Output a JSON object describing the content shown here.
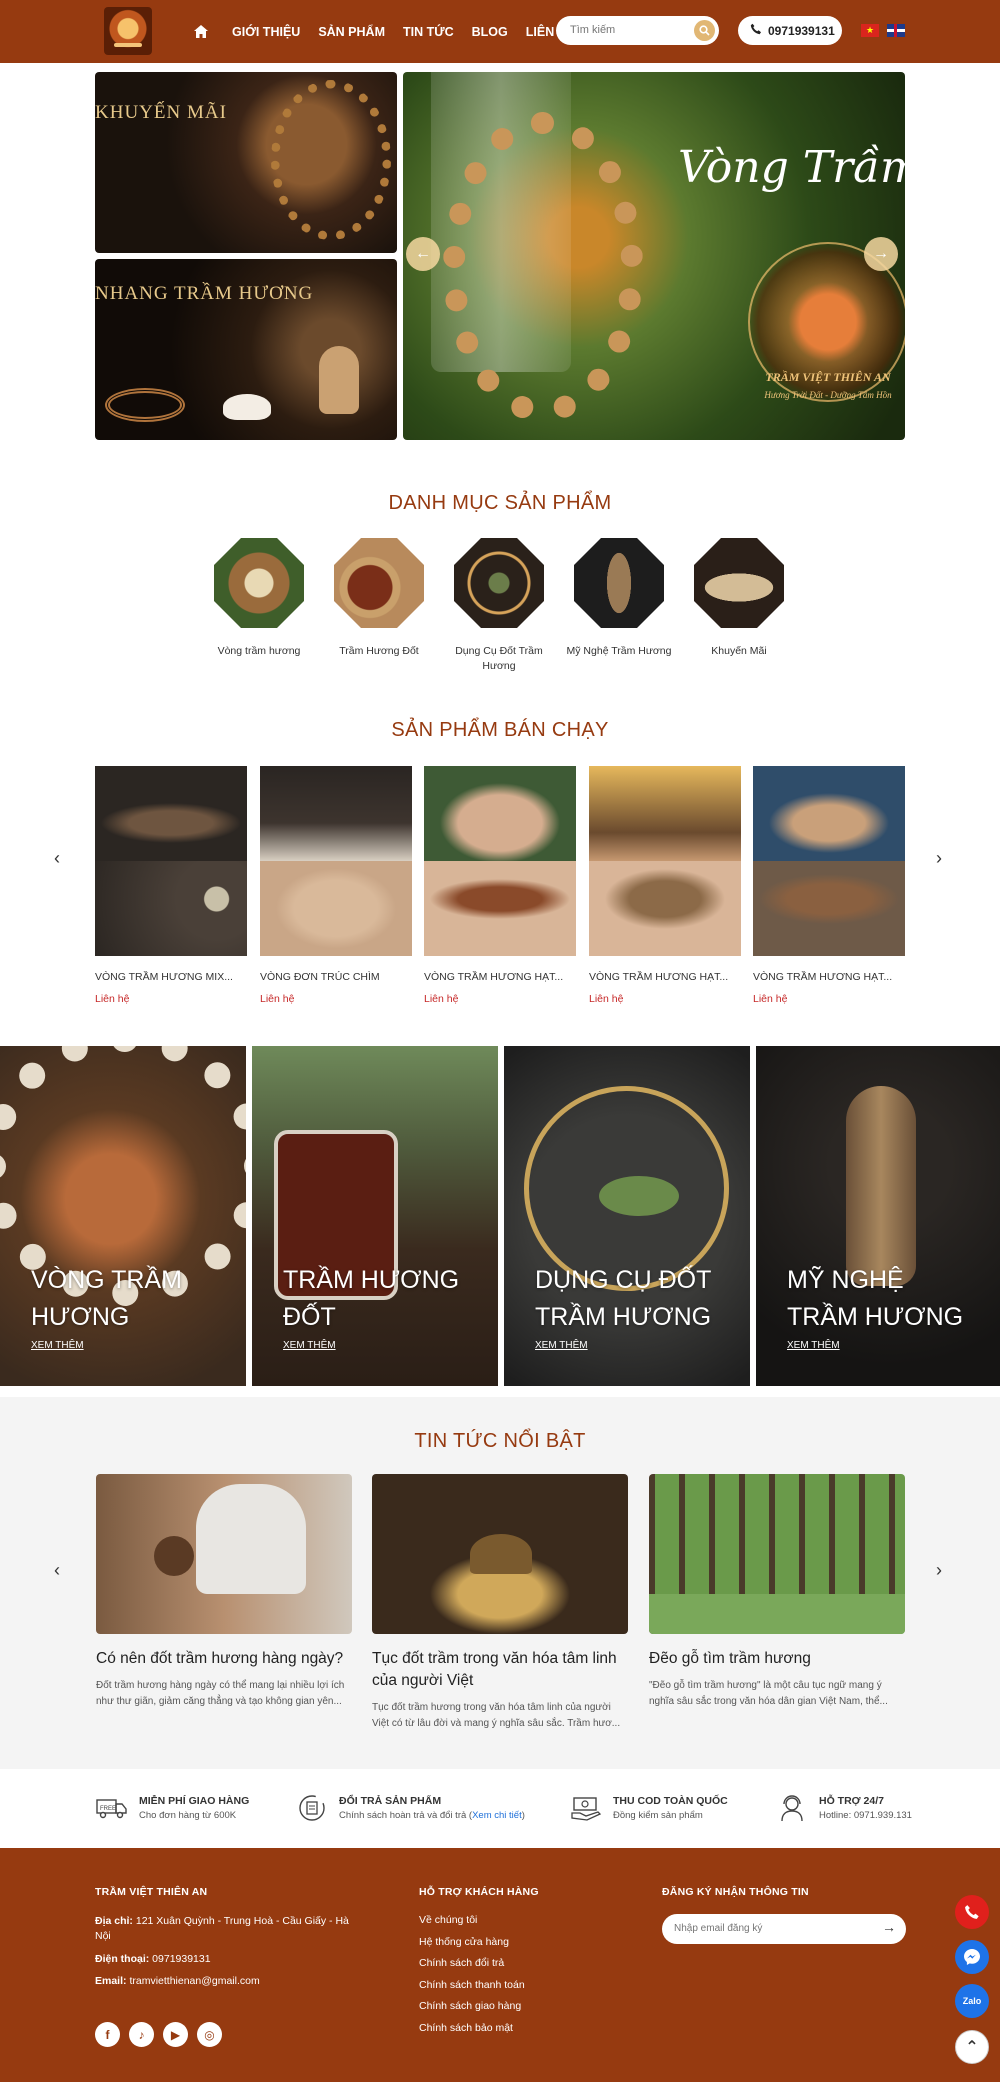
{
  "header": {
    "nav": [
      "GIỚI THIỆU",
      "SẢN PHẨM",
      "TIN TỨC",
      "BLOG",
      "LIÊN HỆ"
    ],
    "search_placeholder": "Tìm kiếm",
    "phone": "0971939131"
  },
  "hero": {
    "promo_1": "KHUYẾN MÃI",
    "promo_2": "NHANG TRẦM HƯƠNG",
    "slide_title": "Vòng Trầm Hương",
    "brand": "TRẦM VIỆT THIÊN AN",
    "slogan": "Hương Trời Đất - Dưỡng Tâm Hồn"
  },
  "categories": {
    "title": "DANH MỤC SẢN PHẨM",
    "items": [
      {
        "label": "Vòng trầm hương"
      },
      {
        "label": "Trầm Hương Đốt"
      },
      {
        "label": "Dụng Cụ Đốt Trầm Hương"
      },
      {
        "label": "Mỹ Nghệ Trầm Hương"
      },
      {
        "label": "Khuyến Mãi"
      }
    ]
  },
  "bestsellers": {
    "title": "SẢN PHẨM BÁN CHẠY",
    "items": [
      {
        "name": "VÒNG TRẦM HƯƠNG MIX...",
        "price": "Liên hệ"
      },
      {
        "name": "VÒNG ĐƠN TRÚC CHÌM",
        "price": "Liên hệ"
      },
      {
        "name": "VÒNG TRẦM HƯƠNG HẠT...",
        "price": "Liên hệ"
      },
      {
        "name": "VÒNG TRẦM HƯƠNG HẠT...",
        "price": "Liên hệ"
      },
      {
        "name": "VÒNG TRẦM HƯƠNG HẠT...",
        "price": "Liên hệ"
      }
    ]
  },
  "banners": {
    "more": "XEM THÊM",
    "items": [
      {
        "line1": "VÒNG TRẦM",
        "line2": "HƯƠNG"
      },
      {
        "line1": "TRẦM HƯƠNG",
        "line2": "ĐỐT"
      },
      {
        "line1": "DỤNG CỤ ĐỐT",
        "line2": "TRẦM HƯƠNG"
      },
      {
        "line1": "MỸ NGHỆ",
        "line2": "TRẦM HƯƠNG"
      }
    ]
  },
  "news": {
    "title": "TIN TỨC NỔI BẬT",
    "items": [
      {
        "title": "Có nên đốt trầm hương hàng ngày?",
        "desc": "Đốt trầm hương hàng ngày có thể mang lại nhiều lợi ích như thư giãn, giảm căng thẳng và tạo không gian yên..."
      },
      {
        "title": "Tục đốt trầm trong văn hóa tâm linh của người Việt",
        "desc": "Tục đốt trầm hương trong văn hóa tâm linh của người Việt có từ lâu đời và mang ý nghĩa sâu sắc. Trầm hươ..."
      },
      {
        "title": "Đẽo gỗ tìm trầm hương",
        "desc": "\"Đẽo gỗ tìm trầm hương\" là một câu tục ngữ mang ý nghĩa sâu sắc trong văn hóa dân gian Việt Nam, thể..."
      }
    ]
  },
  "services": [
    {
      "title": "MIỄN PHÍ GIAO HÀNG",
      "sub": "Cho đơn hàng từ 600K"
    },
    {
      "title": "ĐỔI TRẢ SẢN PHẨM",
      "sub": "Chính sách hoàn trả và đổi trả (",
      "link": "Xem chi tiết",
      "sub_end": ")"
    },
    {
      "title": "THU COD TOÀN QUỐC",
      "sub": "Đồng kiểm sản phẩm"
    },
    {
      "title": "HỖ TRỢ 24/7",
      "sub": "Hotline: 0971.939.131"
    }
  ],
  "footer": {
    "brand": "TRẦM VIỆT THIÊN AN",
    "address_label": "Địa chỉ:",
    "address": "121 Xuân Quỳnh - Trung Hoà - Cầu Giấy - Hà Nội",
    "phone_label": "Điện thoại:",
    "phone": "0971939131",
    "email_label": "Email:",
    "email": "tramvietthienan@gmail.com",
    "support_title": "HỖ TRỢ KHÁCH HÀNG",
    "links": [
      "Về chúng tôi",
      "Hệ thống cửa hàng",
      "Chính sách đổi trả",
      "Chính sách thanh toán",
      "Chính sách giao hàng",
      "Chính sách bảo mật"
    ],
    "subscribe_title": "ĐĂNG KÝ NHẬN THÔNG TIN",
    "subscribe_placeholder": "Nhập email đăng ký"
  },
  "colors": {
    "brand": "#963a10",
    "accent": "#e1b774",
    "price": "#c62828"
  }
}
